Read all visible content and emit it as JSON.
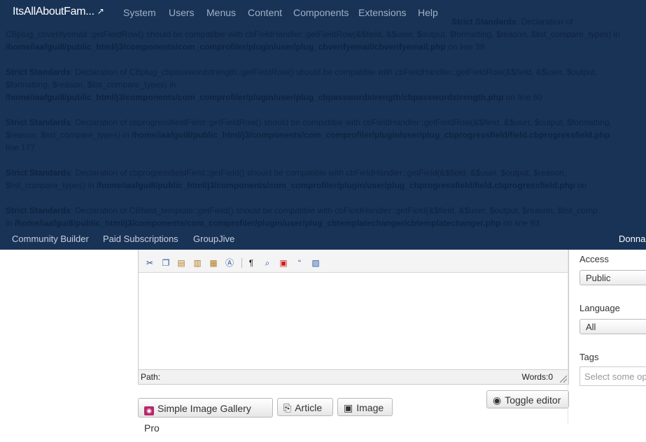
{
  "navbar": {
    "brand": "ItsAllAboutFam...",
    "menu": [
      "System",
      "Users",
      "Menus",
      "Content",
      "Components",
      "Extensions",
      "Help"
    ],
    "submenu": [
      "Community Builder",
      "Paid Subscriptions",
      "GroupJive"
    ],
    "user": "Donna"
  },
  "errors": [
    {
      "lead": "Strict Standards",
      "text": ": Declaration of"
    },
    {
      "text": "CBplug_cbverifyemail::getFieldRow() should be compatible with cbFieldHandler::getFieldRow(&$field, &$user, $output, $formatting, $reason, $list_compare_types) in"
    },
    {
      "path": "/home/iaafgui8/public_html/j3/components/com_comprofiler/plugin/user/plug_cbverifyemail/cbverifyemail.php",
      "line": " on line 39"
    },
    {
      "lead": "Strict Standards",
      "text": ": Declaration of CBplug_cbpasswordstrength::getFieldRow() should be compatible with cbFieldHandler::getFieldRow(&$field, &$user, $output,"
    },
    {
      "text": "$formatting, $reason, $list_compare_types) in"
    },
    {
      "path": "/home/iaafgui8/public_html/j3/components/com_comprofiler/plugin/user/plug_cbpasswordstrength/cbpasswordstrength.php",
      "line": " on line 60"
    },
    {
      "lead": "Strict Standards",
      "text": ": Declaration of cbprogressfieldField::getFieldRow() should be compatible with cbFieldHandler::getFieldRow(&$field, &$user, $output, $formatting,"
    },
    {
      "text": "$reason, $list_compare_types) in ",
      "path": "/home/iaafgui8/public_html/j3/components/com_comprofiler/plugin/user/plug_cbprogressfield/field.cbprogressfield.php"
    },
    {
      "text": "line 177"
    },
    {
      "lead": "Strict Standards",
      "text": ": Declaration of cbprogressfieldField::getField() should be compatible with cbFieldHandler::getField(&$field, &$user, $output, $reason,"
    },
    {
      "text": "$list_compare_types) in ",
      "path": "/home/iaafgui8/public_html/j3/components/com_comprofiler/plugin/user/plug_cbprogressfield/field.cbprogressfield.php",
      "line": " on"
    },
    {
      "lead": "Strict Standards",
      "text": ": Declaration of CBfield_template::getField() should be compatible with cbFieldHandler::getField(&$field, &$user, $output, $reason, $list_comp"
    },
    {
      "text": "in ",
      "path": "/home/iaafgui8/public_html/j3/components/com_comprofiler/plugin/user/plug_cbtemplatechanger/cbtemplatechanger.php",
      "line": " on line 93"
    }
  ],
  "editor": {
    "toolbar_icons": [
      "cut-icon",
      "copy-icon",
      "paste-icon",
      "paste-text-icon",
      "paste-word-icon",
      "select-all-icon",
      "pilcrow-icon",
      "find-icon",
      "anchor-icon",
      "blockquote-icon",
      "template-icon"
    ],
    "path_label": "Path:",
    "words_label": "Words:0"
  },
  "buttons": {
    "gallery": "Simple Image Gallery Pro",
    "article": "Article",
    "image": "Image",
    "toggle": "Toggle editor"
  },
  "sidebar": {
    "access_label": "Access",
    "access_value": "Public",
    "language_label": "Language",
    "language_value": "All",
    "tags_label": "Tags",
    "tags_placeholder": "Select some op"
  },
  "colors": {
    "navbar_bg": "#193357",
    "gallery_icon": "#b8276b"
  }
}
